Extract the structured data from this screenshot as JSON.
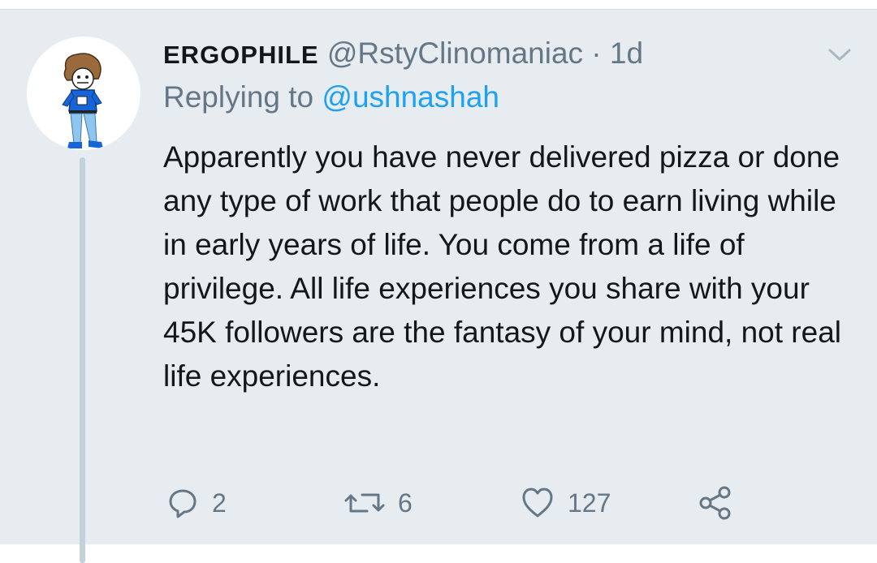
{
  "tweet": {
    "display_name": "ERGOPHILE",
    "handle": "@RstyClinomaniac",
    "separator": " · ",
    "time": "1d",
    "replying_prefix": "Replying to ",
    "replying_to": "@ushnashah",
    "body": "Apparently you have never delivered pizza or done any type of work that people do to earn living while in early years of life. You come from a life of privilege. All life experiences you share with your 45K followers are the fantasy of your mind, not real life experiences."
  },
  "actions": {
    "replies": "2",
    "retweets": "6",
    "likes": "127"
  },
  "icons": [
    "chevron-down-icon",
    "reply-icon",
    "retweet-icon",
    "like-icon",
    "share-icon"
  ],
  "colors": {
    "background": "#e6ecf0",
    "text": "#14171a",
    "secondary": "#657786",
    "link": "#1da1f2",
    "thread_line": "#c4d1db"
  }
}
